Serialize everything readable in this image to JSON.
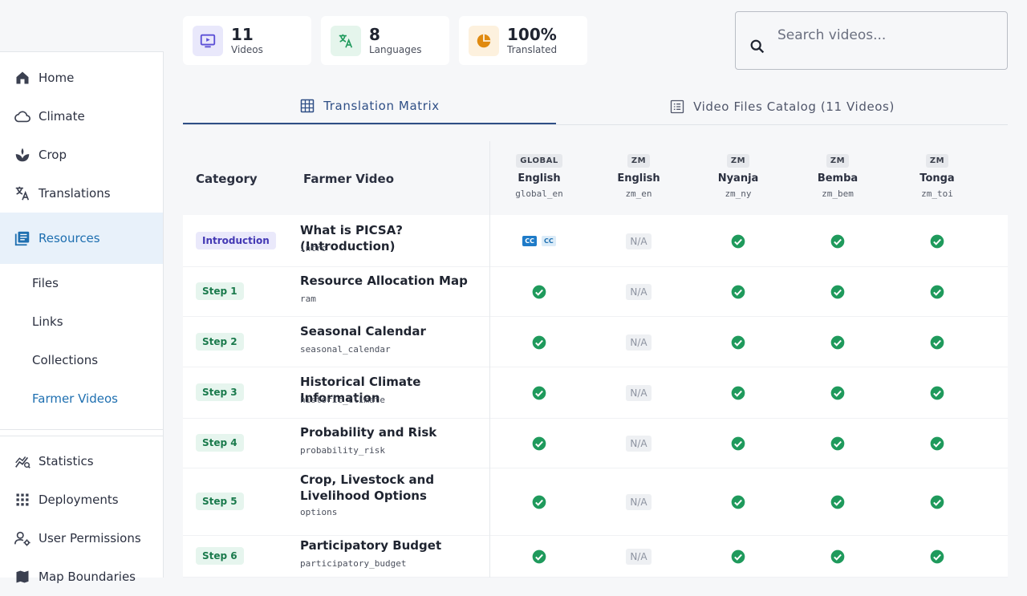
{
  "stats": [
    {
      "value": "11",
      "label": "Videos",
      "icon": "video-icon",
      "bg": "#e9e8fb",
      "color": "#5b4fd6"
    },
    {
      "value": "8",
      "label": "Languages",
      "icon": "translate-icon",
      "bg": "#e5f5ec",
      "color": "#1f9a5c"
    },
    {
      "value": "100%",
      "label": "Translated",
      "icon": "pie-chart-icon",
      "bg": "#fdf1de",
      "color": "#e08a10"
    }
  ],
  "search": {
    "placeholder": "Search videos..."
  },
  "sidebar": {
    "items": [
      {
        "label": "Home",
        "icon": "home-icon"
      },
      {
        "label": "Climate",
        "icon": "cloud-icon"
      },
      {
        "label": "Crop",
        "icon": "sprout-icon"
      },
      {
        "label": "Translations",
        "icon": "translate-icon"
      },
      {
        "label": "Resources",
        "icon": "library-icon"
      }
    ],
    "subitems": [
      "Files",
      "Links",
      "Collections",
      "Farmer Videos"
    ],
    "bottom_items": [
      {
        "label": "Statistics",
        "icon": "chart-icon"
      },
      {
        "label": "Deployments",
        "icon": "apps-icon"
      },
      {
        "label": "User Permissions",
        "icon": "user-gear-icon"
      },
      {
        "label": "Map Boundaries",
        "icon": "map-icon"
      }
    ]
  },
  "tabs": [
    {
      "label": "Translation Matrix",
      "icon": "grid-icon"
    },
    {
      "label": "Video Files Catalog (11 Videos)",
      "icon": "list-icon"
    }
  ],
  "table": {
    "headers": {
      "category": "Category",
      "video": "Farmer Video"
    },
    "languages": [
      {
        "scope": "GLOBAL",
        "name": "English",
        "code": "global_en"
      },
      {
        "scope": "ZM",
        "name": "English",
        "code": "zm_en"
      },
      {
        "scope": "ZM",
        "name": "Nyanja",
        "code": "zm_ny"
      },
      {
        "scope": "ZM",
        "name": "Bemba",
        "code": "zm_bem"
      },
      {
        "scope": "ZM",
        "name": "Tonga",
        "code": "zm_toi"
      }
    ],
    "na_label": "N/A",
    "cc_label": "CC",
    "rows": [
      {
        "category": "Introduction",
        "title": "What is PICSA? (Introduction)",
        "code": "intro",
        "status": [
          "cc",
          "na",
          "ok",
          "ok",
          "ok"
        ]
      },
      {
        "category": "Step 1",
        "title": "Resource Allocation Map",
        "code": "ram",
        "status": [
          "ok",
          "na",
          "ok",
          "ok",
          "ok"
        ]
      },
      {
        "category": "Step 2",
        "title": "Seasonal Calendar",
        "code": "seasonal_calendar",
        "status": [
          "ok",
          "na",
          "ok",
          "ok",
          "ok"
        ]
      },
      {
        "category": "Step 3",
        "title": "Historical Climate Information",
        "code": "historic_climate",
        "status": [
          "ok",
          "na",
          "ok",
          "ok",
          "ok"
        ]
      },
      {
        "category": "Step 4",
        "title": "Probability and Risk",
        "code": "probability_risk",
        "status": [
          "ok",
          "na",
          "ok",
          "ok",
          "ok"
        ]
      },
      {
        "category": "Step 5",
        "title": "Crop, Livestock and Livelihood Options",
        "code": "options",
        "status": [
          "ok",
          "na",
          "ok",
          "ok",
          "ok"
        ]
      },
      {
        "category": "Step 6",
        "title": "Participatory Budget",
        "code": "participatory_budget",
        "status": [
          "ok",
          "na",
          "ok",
          "ok",
          "ok"
        ]
      }
    ]
  },
  "colors": {
    "accent": "#1e6fb0",
    "check": "#1f9a5c",
    "tab_active": "#2f4f86"
  }
}
